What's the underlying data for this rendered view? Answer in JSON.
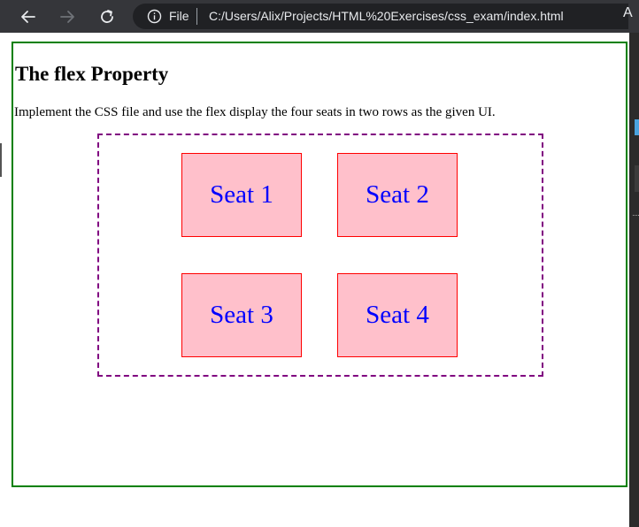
{
  "browser": {
    "file_label": "File",
    "url": "C:/Users/Alix/Projects/HTML%20Exercises/css_exam/index.html",
    "reader_label": "A",
    "icons": [
      "back-icon",
      "forward-icon",
      "reload-icon",
      "info-icon"
    ],
    "theme_color": "#35363a"
  },
  "page": {
    "title": "The flex Property",
    "instruction": "Implement the CSS file and use the flex display the four seats in two rows as the given UI.",
    "frame_border_color": "#008000",
    "container_border_color": "#800080"
  },
  "seats": [
    {
      "label": "Seat 1"
    },
    {
      "label": "Seat 2"
    },
    {
      "label": "Seat 3"
    },
    {
      "label": "Seat 4"
    }
  ],
  "seat_style": {
    "background": "#ffc0cb",
    "border": "#ff0000",
    "text_color": "#0000ff"
  }
}
